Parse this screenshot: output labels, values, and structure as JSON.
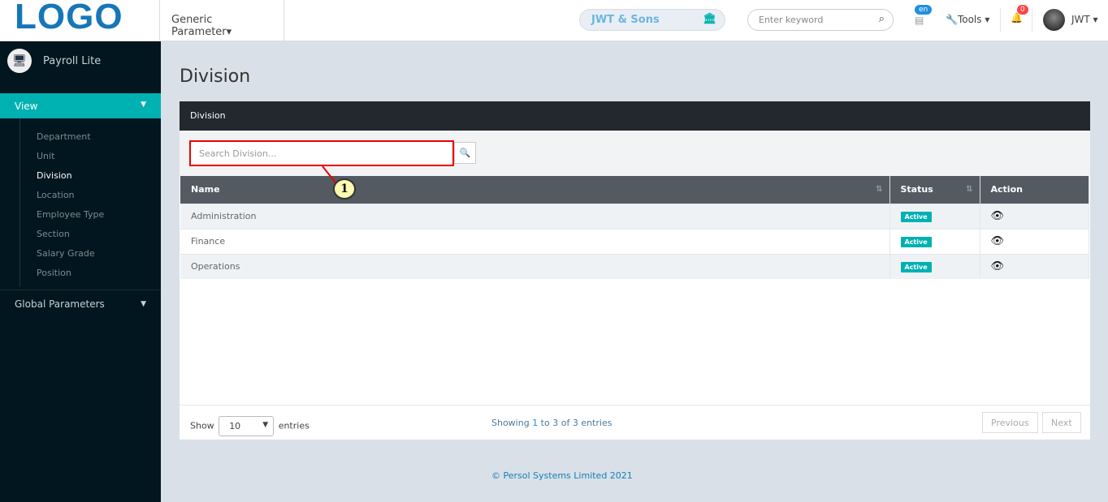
{
  "header": {
    "logo": "LOGO",
    "module": "Generic Parameter",
    "company": "JWT & Sons",
    "search_placeholder": "Enter keyword",
    "lang": "en",
    "tools": "Tools",
    "notifications": "0",
    "user": "JWT"
  },
  "sidebar": {
    "app": "Payroll Lite",
    "view": "View",
    "items": [
      {
        "label": "Department"
      },
      {
        "label": "Unit"
      },
      {
        "label": "Division",
        "active": true
      },
      {
        "label": "Location"
      },
      {
        "label": "Employee Type"
      },
      {
        "label": "Section"
      },
      {
        "label": "Salary Grade"
      },
      {
        "label": "Position"
      }
    ],
    "global": "Global Parameters"
  },
  "page": {
    "title": "Division",
    "panel_title": "Division",
    "search_placeholder": "Search Division...",
    "callout": "1",
    "columns": [
      "Name",
      "Status",
      "Action"
    ],
    "rows": [
      {
        "name": "Administration",
        "status": "Active"
      },
      {
        "name": "Finance",
        "status": "Active"
      },
      {
        "name": "Operations",
        "status": "Active"
      }
    ],
    "show_label": "Show",
    "entries_value": "10",
    "entries_label": "entries",
    "info": {
      "a": "Showing ",
      "b": "1",
      "c": " to 3 of 3 entries"
    },
    "previous": "Previous",
    "next": "Next"
  },
  "footer": "© Persol Systems Limited 2021",
  "colors": {
    "accent": "#00b1b2",
    "sidebar": "#01161e",
    "highlight": "#ee0000"
  }
}
